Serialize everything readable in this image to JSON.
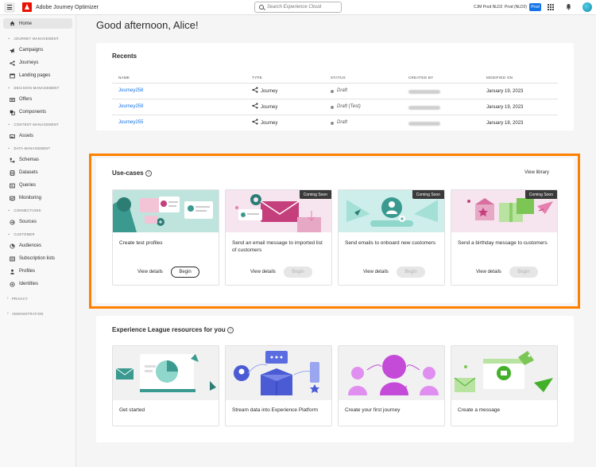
{
  "app": {
    "title": "Adobe Journey Optimizer",
    "search_placeholder": "Search Experience Cloud",
    "org": "CJM Prod NLD2",
    "sandbox": "Prod (NLD2)",
    "env_badge": "Prod"
  },
  "sidebar": {
    "home": "Home",
    "sections": [
      {
        "label": "JOURNEY MANAGEMENT",
        "items": [
          "Campaigns",
          "Journeys",
          "Landing pages"
        ]
      },
      {
        "label": "DECISION MANAGEMENT",
        "items": [
          "Offers",
          "Components"
        ]
      },
      {
        "label": "CONTENT MANAGEMENT",
        "items": [
          "Assets"
        ]
      },
      {
        "label": "DATA MANAGEMENT",
        "items": [
          "Schemas",
          "Datasets",
          "Queries",
          "Monitoring"
        ]
      },
      {
        "label": "CONNECTIONS",
        "items": [
          "Sources"
        ]
      },
      {
        "label": "CUSTOMER",
        "items": [
          "Audiences",
          "Subscription lists",
          "Profiles",
          "Identities"
        ]
      }
    ],
    "collapsed": [
      "PRIVACY",
      "ADMINISTRATION"
    ]
  },
  "greeting": "Good afternoon, Alice!",
  "recents": {
    "title": "Recents",
    "columns": [
      "NAME",
      "TYPE",
      "STATUS",
      "CREATED BY",
      "MODIFIED ON"
    ],
    "rows": [
      {
        "name": "Journey258",
        "type": "Journey",
        "status": "Draft",
        "modified": "January 19, 2023"
      },
      {
        "name": "Journey259",
        "type": "Journey",
        "status": "Draft (Test)",
        "modified": "January 19, 2023"
      },
      {
        "name": "Journey255",
        "type": "Journey",
        "status": "Draft",
        "modified": "January 18, 2023"
      }
    ]
  },
  "usecases": {
    "title": "Use-cases",
    "view_library": "View library",
    "view_details": "View details",
    "begin": "Begin",
    "coming_soon": "Coming Soon",
    "tiles": [
      {
        "title": "Create test profiles"
      },
      {
        "title": "Send an email message to imported list of customers"
      },
      {
        "title": "Send emails to onboard new customers"
      },
      {
        "title": "Send a birthday message to customers"
      }
    ]
  },
  "league": {
    "title": "Experience League resources for you",
    "tiles": [
      {
        "title": "Get started"
      },
      {
        "title": "Stream data into Experience Platform"
      },
      {
        "title": "Create your first journey"
      },
      {
        "title": "Create a message"
      }
    ]
  }
}
